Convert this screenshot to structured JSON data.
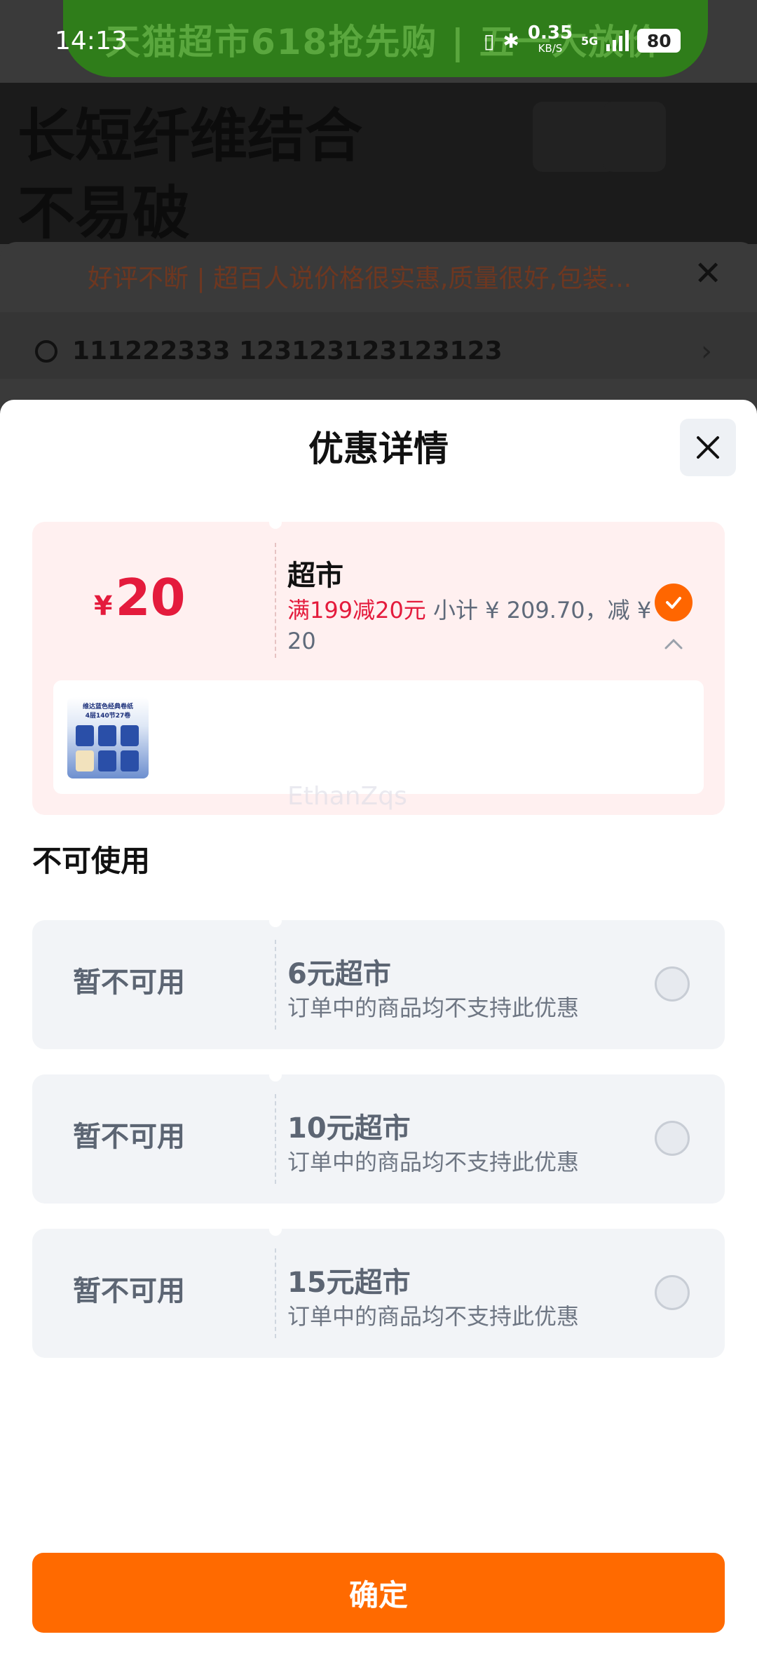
{
  "status_bar": {
    "time": "14:13",
    "net_speed": "0.35",
    "net_unit": "KB/S",
    "network": "5G",
    "battery": "80"
  },
  "background": {
    "banner_text": "天猫超市618抢先购 | 五一大放价",
    "hero_title": "长短纤维结合 不易破",
    "notice_text": "好评不断 | 超百人说价格很实惠,质量很好,包装...",
    "address": "111222333 123123123123123"
  },
  "sheet": {
    "title": "优惠详情",
    "selected_coupon": {
      "currency": "¥",
      "amount": "20",
      "name": "超市",
      "rule": "满199减20元",
      "summary": " 小计 ¥ 209.70，减 ¥ 20",
      "product_label": "维达蓝色经典卷纸",
      "product_spec": "4层140节27卷"
    },
    "watermark": "EthanZqs",
    "unavailable_title": "不可使用",
    "unavailable": [
      {
        "label": "暂不可用",
        "name": "6元超市",
        "reason": "订单中的商品均不支持此优惠"
      },
      {
        "label": "暂不可用",
        "name": "10元超市",
        "reason": "订单中的商品均不支持此优惠"
      },
      {
        "label": "暂不可用",
        "name": "15元超市",
        "reason": "订单中的商品均不支持此优惠"
      }
    ],
    "confirm_label": "确定"
  },
  "colors": {
    "accent_orange": "#ff6a00",
    "discount_red": "#e41b3c",
    "selected_card_bg": "#fff0f0",
    "disabled_card_bg": "#f2f4f7"
  }
}
